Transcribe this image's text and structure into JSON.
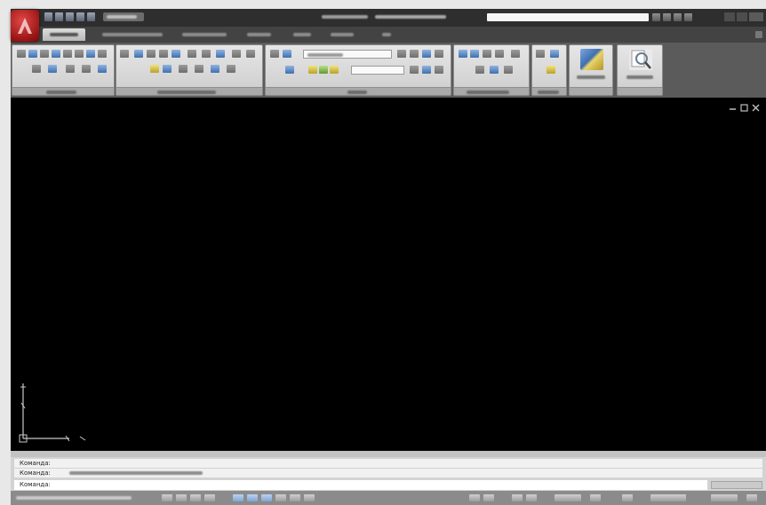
{
  "colors": {
    "title_bar": "#2e2e2e",
    "tab_row": "#434343",
    "ribbon_background": "#5b5b5b",
    "panel": "#d9d9d9",
    "drawing_area": "#000000",
    "command_area": "#d3d3d3",
    "status_bar": "#8b8b8b",
    "app_button": "#b51f1f"
  },
  "icons": {
    "app_button": "autodesk-app-icon",
    "viewport_controls": [
      "minimize-icon",
      "restore-icon",
      "close-icon"
    ],
    "ucs": "ucs-icon"
  },
  "ribbon": {
    "active_tab_index": 0,
    "tab_count": 7,
    "panel_count": 7
  },
  "command_line": {
    "lines": [
      "Команда:",
      "Команда:",
      "Команда:"
    ]
  }
}
